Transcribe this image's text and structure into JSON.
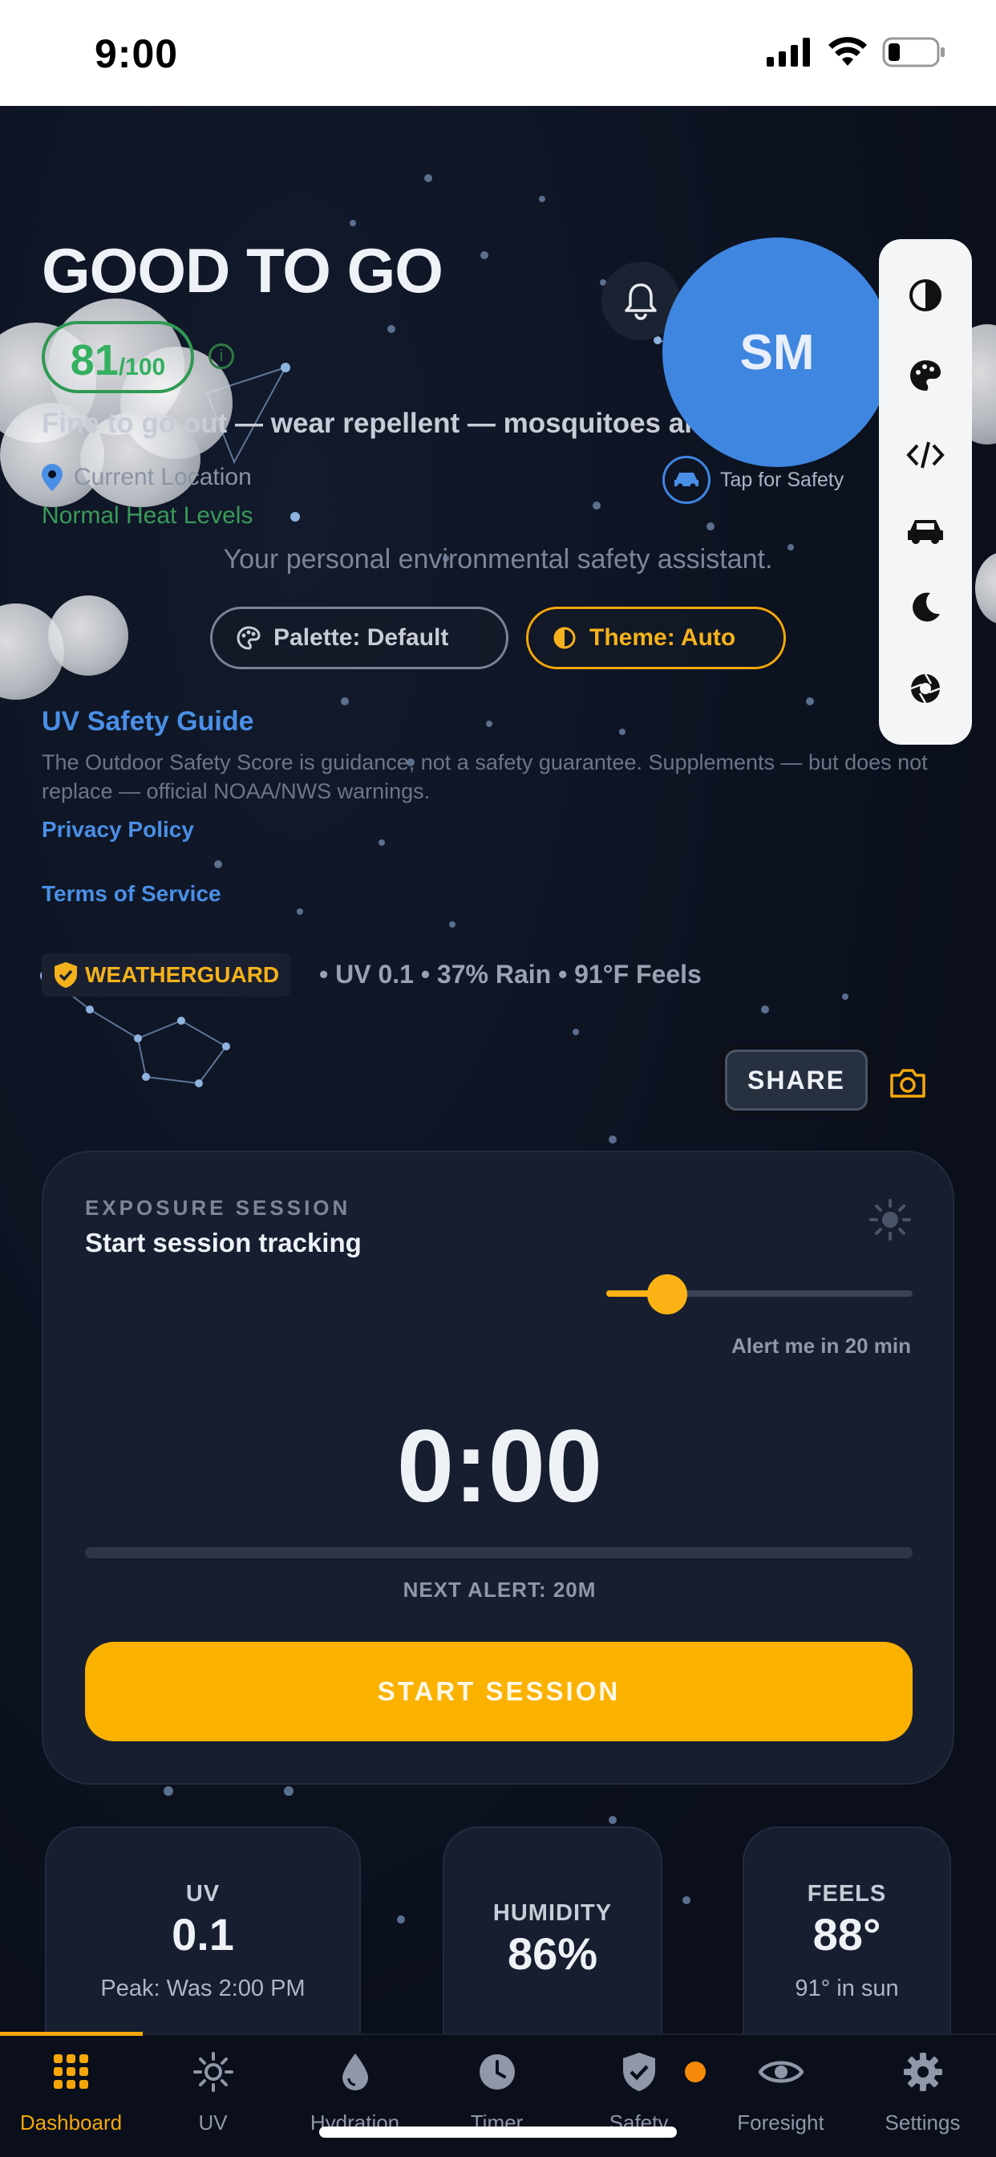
{
  "status_bar": {
    "time": "9:00"
  },
  "header": {
    "headline": "GOOD TO GO",
    "score": "81",
    "score_max": "/100",
    "summary": "Fine to go out — wear repellent — mosquitoes are out.",
    "location": "Current Location",
    "heat_status": "Normal Heat Levels",
    "tagline": "Your personal environmental safety assistant."
  },
  "controls": {
    "palette_label": "Palette: Default",
    "theme_label": "Theme: Auto"
  },
  "avatar": {
    "initials": "SM",
    "safety_hint": "Tap for Safety"
  },
  "links": {
    "uv_guide": "UV Safety Guide",
    "disclaimer": "The Outdoor Safety Score is guidance, not a safety guarantee. Supplements — but does not replace — official NOAA/NWS warnings.",
    "privacy": "Privacy Policy",
    "terms": "Terms of Service"
  },
  "weatherguard": {
    "brand": "WEATHERGUARD",
    "stats": "• UV 0.1 • 37% Rain • 91°F Feels"
  },
  "share": {
    "label": "SHARE"
  },
  "rail_icons": [
    "contrast-icon",
    "palette-icon",
    "code-icon",
    "car-icon",
    "moon-icon",
    "aperture-icon"
  ],
  "exposure": {
    "eyebrow": "EXPOSURE SESSION",
    "title": "Start session tracking",
    "alert_label": "Alert me in 20 min",
    "alert_slider_fraction": 0.2,
    "timer": "0:00",
    "progress_fraction": 0,
    "next_alert": "NEXT ALERT: 20M",
    "start_label": "START SESSION"
  },
  "metrics": [
    {
      "label": "UV",
      "value": "0.1",
      "sub": "Peak: Was 2:00 PM"
    },
    {
      "label": "HUMIDITY",
      "value": "86%",
      "sub": ""
    },
    {
      "label": "FEELS",
      "value": "88°",
      "sub": "91° in sun"
    }
  ],
  "tabs": [
    {
      "label": "Dashboard",
      "icon": "grid-icon",
      "active": true
    },
    {
      "label": "UV",
      "icon": "sun-icon",
      "active": false
    },
    {
      "label": "Hydration",
      "icon": "drop-icon",
      "active": false
    },
    {
      "label": "Timer",
      "icon": "clock-icon",
      "active": false
    },
    {
      "label": "Safety",
      "icon": "shield-icon",
      "active": false
    },
    {
      "label": "Foresight",
      "icon": "eye-icon",
      "active": false
    },
    {
      "label": "Settings",
      "icon": "gear-icon",
      "active": false
    }
  ],
  "colors": {
    "accent": "#f5a70a",
    "link": "#4a8fe6",
    "success": "#34b060",
    "avatar": "#3f86e0",
    "background": "#0c1220",
    "card": "#161e30"
  }
}
